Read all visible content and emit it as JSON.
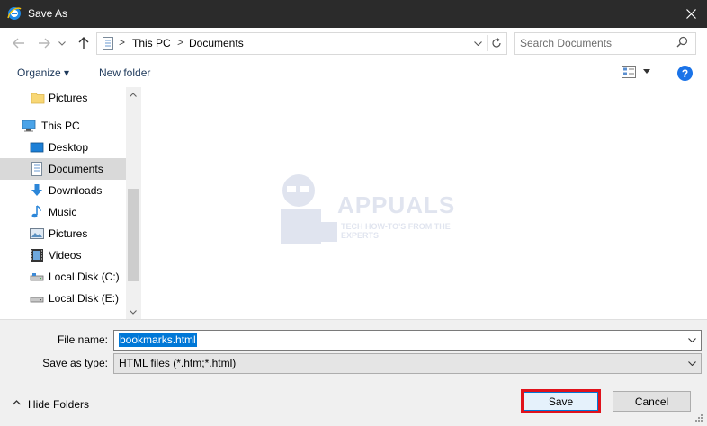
{
  "window": {
    "title": "Save As",
    "app_icon": "ie-icon"
  },
  "address": {
    "crumbs": [
      "This PC",
      "Documents"
    ],
    "separator": ">",
    "search_placeholder": "Search Documents"
  },
  "toolbar": {
    "organize_label": "Organize ▾",
    "new_folder_label": "New folder",
    "help_label": "?"
  },
  "nav": {
    "items": [
      {
        "label": "Pictures",
        "icon": "folder-icon"
      },
      {
        "label": "This PC",
        "icon": "computer-icon"
      },
      {
        "label": "Desktop",
        "icon": "desktop-icon"
      },
      {
        "label": "Documents",
        "icon": "documents-icon",
        "selected": true
      },
      {
        "label": "Downloads",
        "icon": "download-icon"
      },
      {
        "label": "Music",
        "icon": "music-icon"
      },
      {
        "label": "Pictures",
        "icon": "pictures-icon"
      },
      {
        "label": "Videos",
        "icon": "videos-icon"
      },
      {
        "label": "Local Disk (C:)",
        "icon": "drive-icon"
      },
      {
        "label": "Local Disk (E:)",
        "icon": "drive-icon"
      }
    ]
  },
  "watermark": {
    "text": "APPUALS",
    "subtext": "TECH HOW-TO'S FROM THE EXPERTS"
  },
  "form": {
    "file_name_label": "File name:",
    "file_name_value": "bookmarks.html",
    "save_type_label": "Save as type:",
    "save_type_value": "HTML files (*.htm;*.html)"
  },
  "footer": {
    "hide_folders_label": "Hide Folders",
    "save_label": "Save",
    "cancel_label": "Cancel"
  },
  "colors": {
    "accent": "#0078d7",
    "highlight_border": "#e0121c",
    "titlebar": "#2b2b2b"
  }
}
